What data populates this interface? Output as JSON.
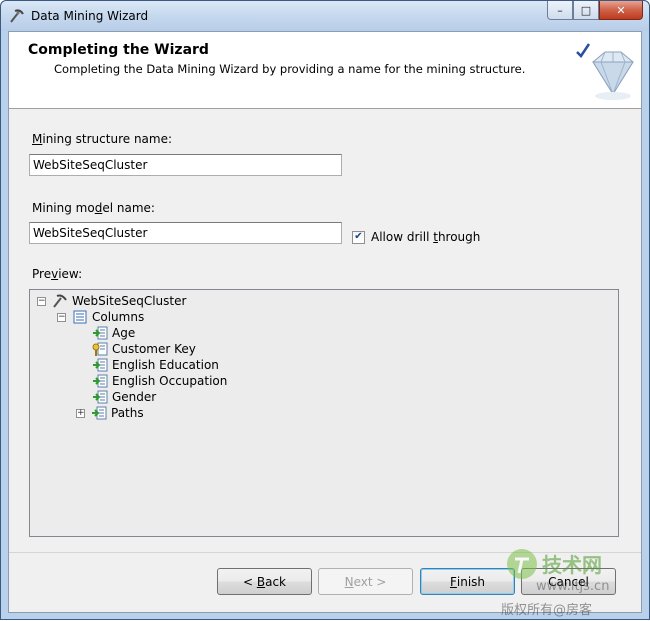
{
  "window": {
    "title": "Data Mining Wizard",
    "controls": {
      "minimize": "–",
      "maximize": "□",
      "close": "✕"
    }
  },
  "header": {
    "title": "Completing the Wizard",
    "subtitle": "Completing the Data Mining Wizard by providing a name for the mining structure.",
    "logo_icon": "diamond-check-icon"
  },
  "form": {
    "structure_label_hotkey": "M",
    "structure_label_rest": "ining structure name:",
    "structure_value": "WebSiteSeqCluster",
    "model_label_pre": "Mining mo",
    "model_label_hotkey": "d",
    "model_label_post": "el name:",
    "model_value": "WebSiteSeqCluster",
    "drill_label_pre": "Allow drill ",
    "drill_label_hotkey": "t",
    "drill_label_post": "hrough",
    "drill_checked": true,
    "preview_label_pre": "Pre",
    "preview_label_hotkey": "v",
    "preview_label_post": "iew:"
  },
  "tree": {
    "root": {
      "label": "WebSiteSeqCluster",
      "expanded": true,
      "icon": "mining-structure-icon"
    },
    "columns": {
      "label": "Columns",
      "expanded": true,
      "icon": "columns-folder-icon"
    },
    "items": [
      {
        "label": "Age",
        "icon": "input-column-icon"
      },
      {
        "label": "Customer Key",
        "icon": "key-column-icon"
      },
      {
        "label": "English Education",
        "icon": "input-column-icon"
      },
      {
        "label": "English Occupation",
        "icon": "input-column-icon"
      },
      {
        "label": "Gender",
        "icon": "input-column-icon"
      },
      {
        "label": "Paths",
        "icon": "nested-table-icon",
        "expandable": true
      }
    ]
  },
  "buttons": {
    "back_pre": "< ",
    "back_hotkey": "B",
    "back_post": "ack",
    "next_hotkey": "N",
    "next_post": "ext >",
    "finish_hotkey": "F",
    "finish_post": "inish",
    "cancel": "Cancel"
  },
  "watermark": {
    "brand": "技术网",
    "url": "www.itjs.cn",
    "rights": "版权所有@房客  "
  }
}
